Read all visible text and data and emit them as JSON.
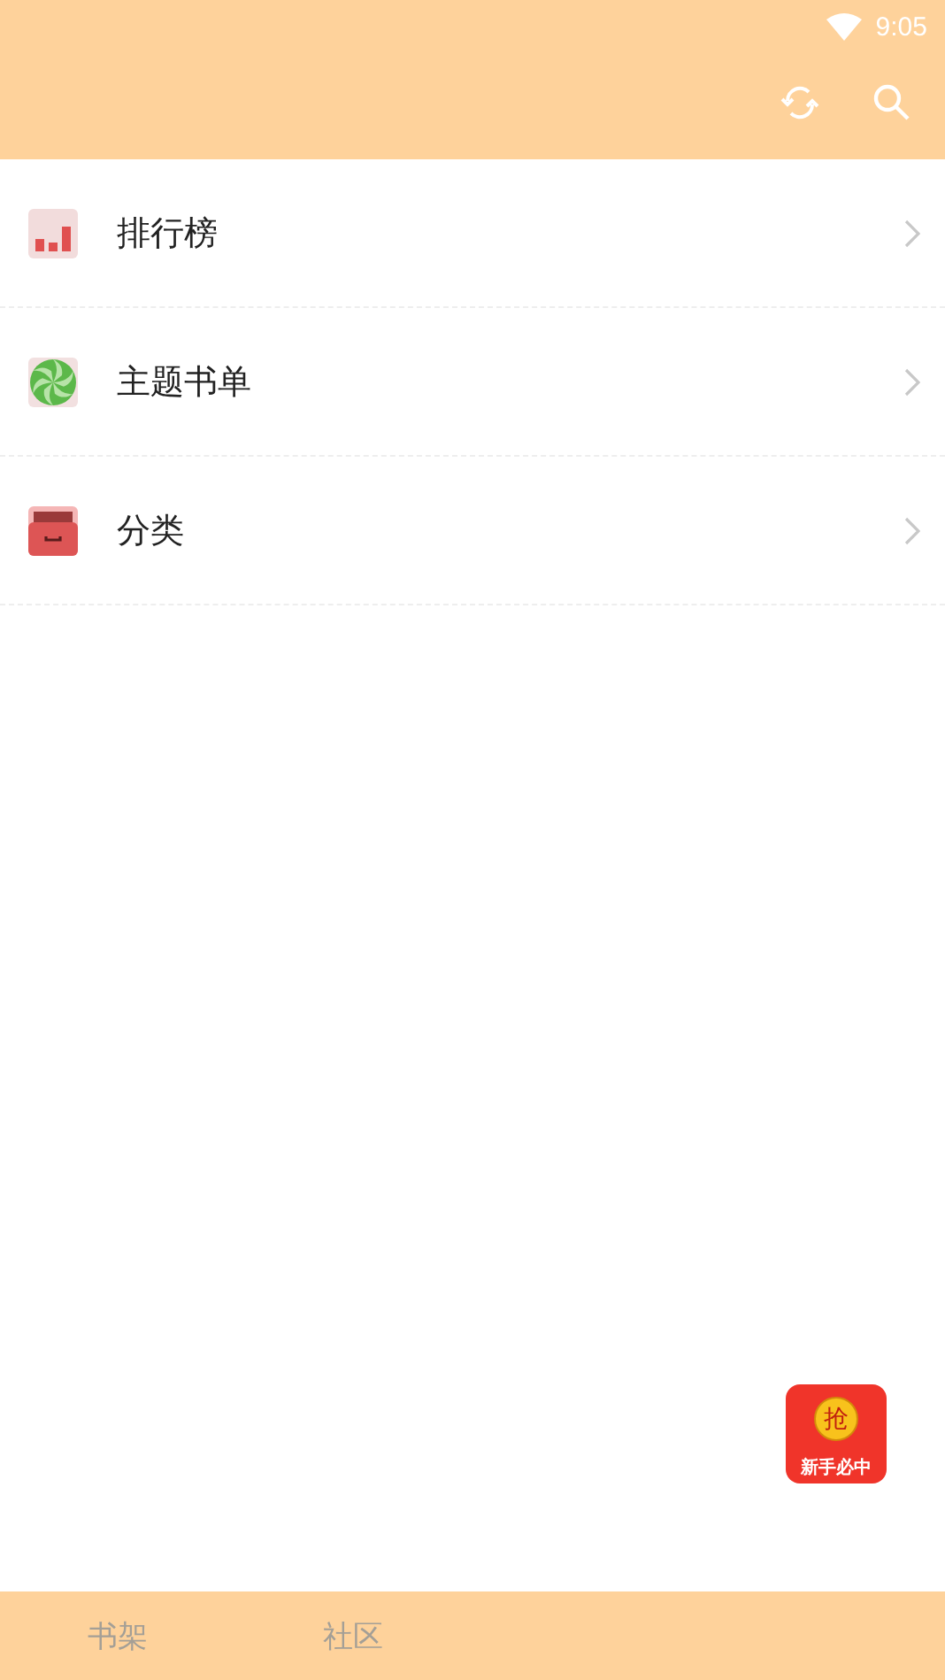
{
  "status_bar": {
    "time": "9:05"
  },
  "menu": [
    {
      "kind": "ranking",
      "label": "排行榜"
    },
    {
      "kind": "booklist",
      "label": "主题书单"
    },
    {
      "kind": "category",
      "label": "分类"
    }
  ],
  "promo": {
    "coin": "抢",
    "label": "新手必中"
  },
  "tabs": [
    {
      "label": "书架",
      "selected": false
    },
    {
      "label": "社区",
      "selected": false
    }
  ]
}
